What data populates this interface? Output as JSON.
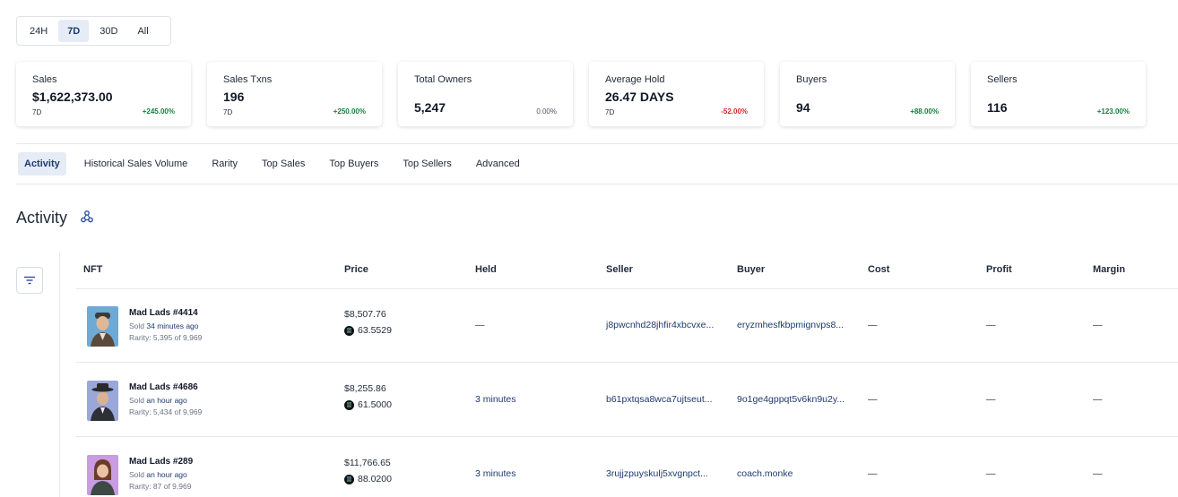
{
  "time_range": {
    "options": [
      "24H",
      "7D",
      "30D",
      "All"
    ],
    "selected": "7D"
  },
  "stats": [
    {
      "label": "Sales",
      "value": "$1,622,373.00",
      "period": "7D",
      "change": "+245.00%",
      "trend": "up"
    },
    {
      "label": "Sales Txns",
      "value": "196",
      "period": "7D",
      "change": "+250.00%",
      "trend": "up"
    },
    {
      "label": "Total Owners",
      "value": "5,247",
      "period": "",
      "change": "0.00%",
      "trend": "flat"
    },
    {
      "label": "Average Hold",
      "value": "26.47 DAYS",
      "period": "7D",
      "change": "-52.00%",
      "trend": "down"
    },
    {
      "label": "Buyers",
      "value": "94",
      "period": "",
      "change": "+88.00%",
      "trend": "up"
    },
    {
      "label": "Sellers",
      "value": "116",
      "period": "",
      "change": "+123.00%",
      "trend": "up"
    }
  ],
  "tabs": [
    "Activity",
    "Historical Sales Volume",
    "Rarity",
    "Top Sales",
    "Top Buyers",
    "Top Sellers",
    "Advanced"
  ],
  "active_tab": "Activity",
  "section": {
    "title": "Activity",
    "share_icon": "share-nodes-icon",
    "filter_icon": "filter-lines-icon"
  },
  "table": {
    "columns": [
      "NFT",
      "Price",
      "Held",
      "Seller",
      "Buyer",
      "Cost",
      "Profit",
      "Margin"
    ],
    "rows": [
      {
        "name": "Mad Lads #4414",
        "sold_prefix": "Sold",
        "sold_ago": "34 minutes ago",
        "rarity": "Rarity: 5,395 of 9,969",
        "price_usd": "$8,507.76",
        "price_sol": "63.5529",
        "held": "—",
        "seller": "j8pwcnhd28jhfir4xbcvxe...",
        "buyer": "eryzmhesfkbpmignvps8...",
        "cost": "—",
        "profit": "—",
        "margin": "—",
        "avatar_bg": "#6fa9d6"
      },
      {
        "name": "Mad Lads #4686",
        "sold_prefix": "Sold",
        "sold_ago": "an hour ago",
        "rarity": "Rarity: 5,434 of 9,969",
        "price_usd": "$8,255.86",
        "price_sol": "61.5000",
        "held": "3 minutes",
        "seller": "b61pxtqsa8wca7ujtseut...",
        "buyer": "9o1ge4gppqt5v6kn9u2y...",
        "cost": "—",
        "profit": "—",
        "margin": "—",
        "avatar_bg": "#9aa7d9"
      },
      {
        "name": "Mad Lads #289",
        "sold_prefix": "Sold",
        "sold_ago": "an hour ago",
        "rarity": "Rarity: 87 of 9,969",
        "price_usd": "$11,766.65",
        "price_sol": "88.0200",
        "held": "3 minutes",
        "seller": "3rujjzpuyskulj5xvgnpct...",
        "buyer": "coach.monke",
        "cost": "—",
        "profit": "—",
        "margin": "—",
        "avatar_bg": "#c99be0"
      }
    ]
  },
  "colors": {
    "accent": "#1e3a70",
    "positive": "#15803d",
    "negative": "#dc2626"
  }
}
